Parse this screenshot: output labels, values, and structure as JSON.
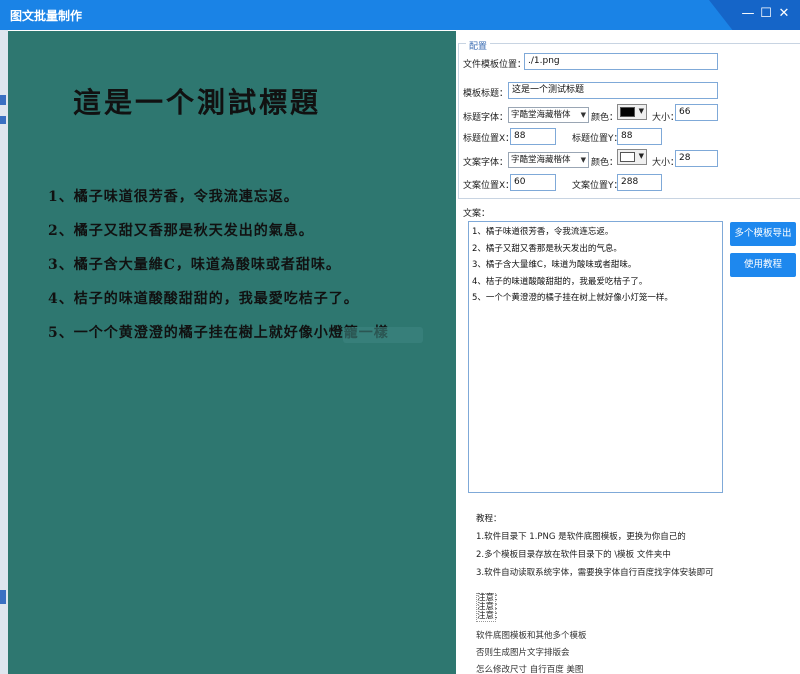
{
  "window": {
    "title": "图文批量制作",
    "controls": {
      "minimize": "—",
      "maximize": "☐",
      "close": "✕"
    }
  },
  "canvas": {
    "background": "#2e7770",
    "title": "這是一个測試標題",
    "lines": [
      "1、橘子味道很芳香，令我流連忘返。",
      "2、橘子又甜又香那是秋天发出的氣息。",
      "3、橘子含大量維C，味道為酸味或者甜味。",
      "4、桔子的味道酸酸甜甜的，我最愛吃桔子了。",
      "5、一个个黄澄澄的橘子挂在樹上就好像小燈籠一樣"
    ]
  },
  "config": {
    "legend": "配置",
    "template_path_label": "文件模板位置：",
    "template_path_value": "./1.png",
    "template_title_label": "模板标题：",
    "template_title_value": "这是一个测试标题",
    "title_font_label": "标题字体：",
    "title_font_value": "字酷堂海藏楷体",
    "title_color_label": "颜色：",
    "title_color_value": "#000000",
    "title_size_label": "大小：",
    "title_size_value": "66",
    "title_x_label": "标题位置X：",
    "title_x_value": "88",
    "title_y_label": "标题位置Y：",
    "title_y_value": "88",
    "text_font_label": "文案字体：",
    "text_font_value": "字酷堂海藏楷体",
    "text_color_label": "颜色：",
    "text_color_value": "#ffffff",
    "text_size_label": "大小：",
    "text_size_value": "28",
    "text_x_label": "文案位置X：",
    "text_x_value": "60",
    "text_y_label": "文案位置Y：",
    "text_y_value": "288"
  },
  "copy": {
    "label": "文案：",
    "lines": [
      "1、橘子味道很芳香，令我流连忘返。",
      "2、橘子又甜又香那是秋天发出的气息。",
      "3、橘子含大量维C，味道为酸味或者甜味。",
      "4、桔子的味道酸酸甜甜的，我最爱吃桔子了。",
      "5、一个个黄澄澄的橘子挂在树上就好像小灯笼一样。"
    ]
  },
  "buttons": {
    "export": "多个模板导出",
    "tutorial": "使用教程"
  },
  "tutorial": {
    "heading": "教程：",
    "steps": [
      "1.软件目录下 1.PNG 是软件底图模板，更换为你自己的",
      "2.多个模板目录存放在软件目录下的 \\模板 文件夹中",
      "3.软件自动读取系统字体，需要换字体自行百度找字体安装即可"
    ],
    "notes": [
      "注意：",
      "注意：",
      "注意："
    ],
    "bottom": [
      "软件底图模板和其他多个模板",
      "否则生成图片文字排版会",
      "怎么修改尺寸 自行百度 美图"
    ]
  }
}
